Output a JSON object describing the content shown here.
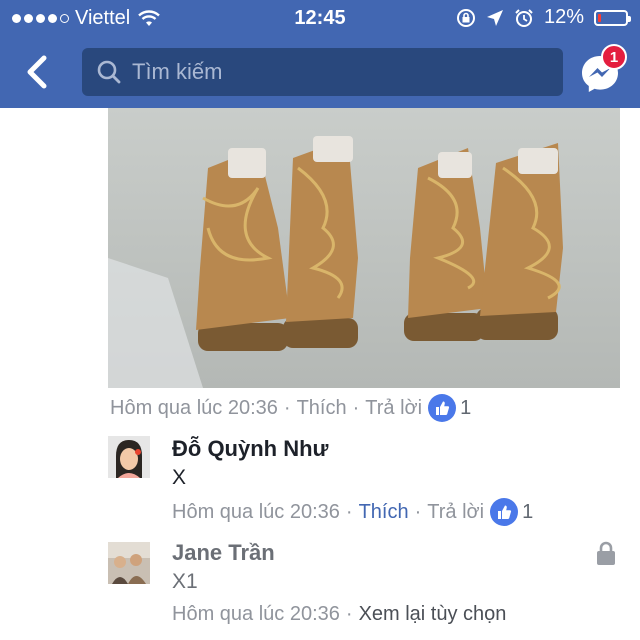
{
  "status_bar": {
    "carrier": "Viettel",
    "time": "12:45",
    "battery": "12%",
    "battery_level": 0.12,
    "signal_bars": 4,
    "icons": [
      "wifi-icon",
      "orientation-lock-icon",
      "location-icon",
      "alarm-icon",
      "battery-icon"
    ]
  },
  "header": {
    "search_placeholder": "Tìm kiếm",
    "messenger_badge": "1",
    "colors": {
      "bar": "#4267b2",
      "search_bg": "#29487d",
      "badge": "#e41e3f"
    }
  },
  "post_meta": {
    "time": "Hôm qua lúc 20:36",
    "separator": "·",
    "like": "Thích",
    "reply": "Trả lời",
    "like_count": "1"
  },
  "comments": [
    {
      "name": "Đỗ Quỳnh Như",
      "text": "X",
      "time": "Hôm qua lúc 20:36",
      "like": "Thích",
      "reply": "Trả lời",
      "like_count": "1",
      "liked": true
    },
    {
      "name": "Jane Trần",
      "text": "X1",
      "time": "Hôm qua lúc 20:36",
      "options": "Xem lại tùy chọn",
      "pending": true
    }
  ]
}
